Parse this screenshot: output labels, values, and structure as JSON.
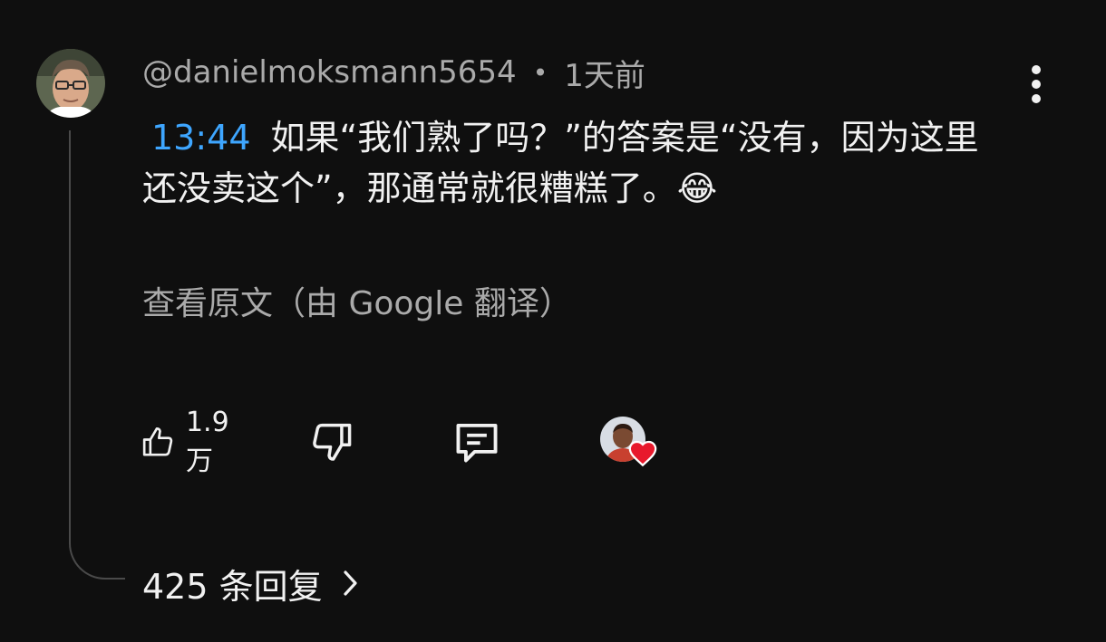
{
  "comment": {
    "author": "@danielmoksmann5654",
    "separator": "•",
    "time_ago": "1天前",
    "timestamp_link": "13:44",
    "text": "如果“我们熟了吗？”的答案是“没有，因为这里还没卖这个”，那通常就很糟糕了。😂",
    "translate_link": "查看原文（由 Google 翻译）",
    "like_count": "1.9万",
    "replies_label": "425 条回复",
    "icons": {
      "avatar": "user-avatar",
      "more": "more-vert-icon",
      "like": "thumb-up-icon",
      "dislike": "thumb-down-icon",
      "reply": "comment-icon",
      "creator_heart": "creator-heart-icon",
      "replies_chevron": "chevron-right-icon"
    },
    "colors": {
      "background": "#0f0f0f",
      "timestamp": "#3ea6ff",
      "meta_text": "#aaaaaa",
      "heart": "#e8192c"
    }
  }
}
